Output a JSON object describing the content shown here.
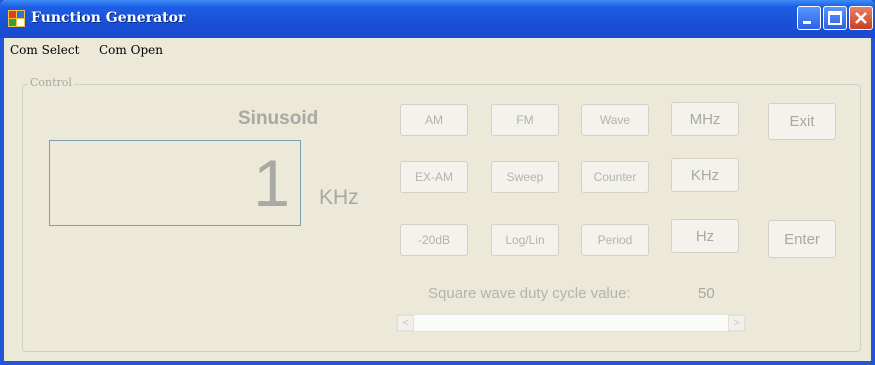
{
  "window": {
    "title": "Function Generator"
  },
  "menu": {
    "items": [
      "Com Select",
      "Com Open"
    ]
  },
  "control": {
    "group_label": "Control",
    "waveform_label": "Sinusoid",
    "display_value": "1",
    "unit_label": "KHz",
    "buttons": {
      "am": "AM",
      "fm": "FM",
      "wave": "Wave",
      "mhz": "MHz",
      "exit": "Exit",
      "ex_am": "EX-AM",
      "sweep": "Sweep",
      "counter": "Counter",
      "khz": "KHz",
      "minus20db": "-20dB",
      "log_lin": "Log/Lin",
      "period": "Period",
      "hz": "Hz",
      "enter": "Enter"
    },
    "duty_label": "Square wave duty cycle value:",
    "duty_value": "50",
    "scroll_left_icon": "<",
    "scroll_right_icon": ">"
  }
}
